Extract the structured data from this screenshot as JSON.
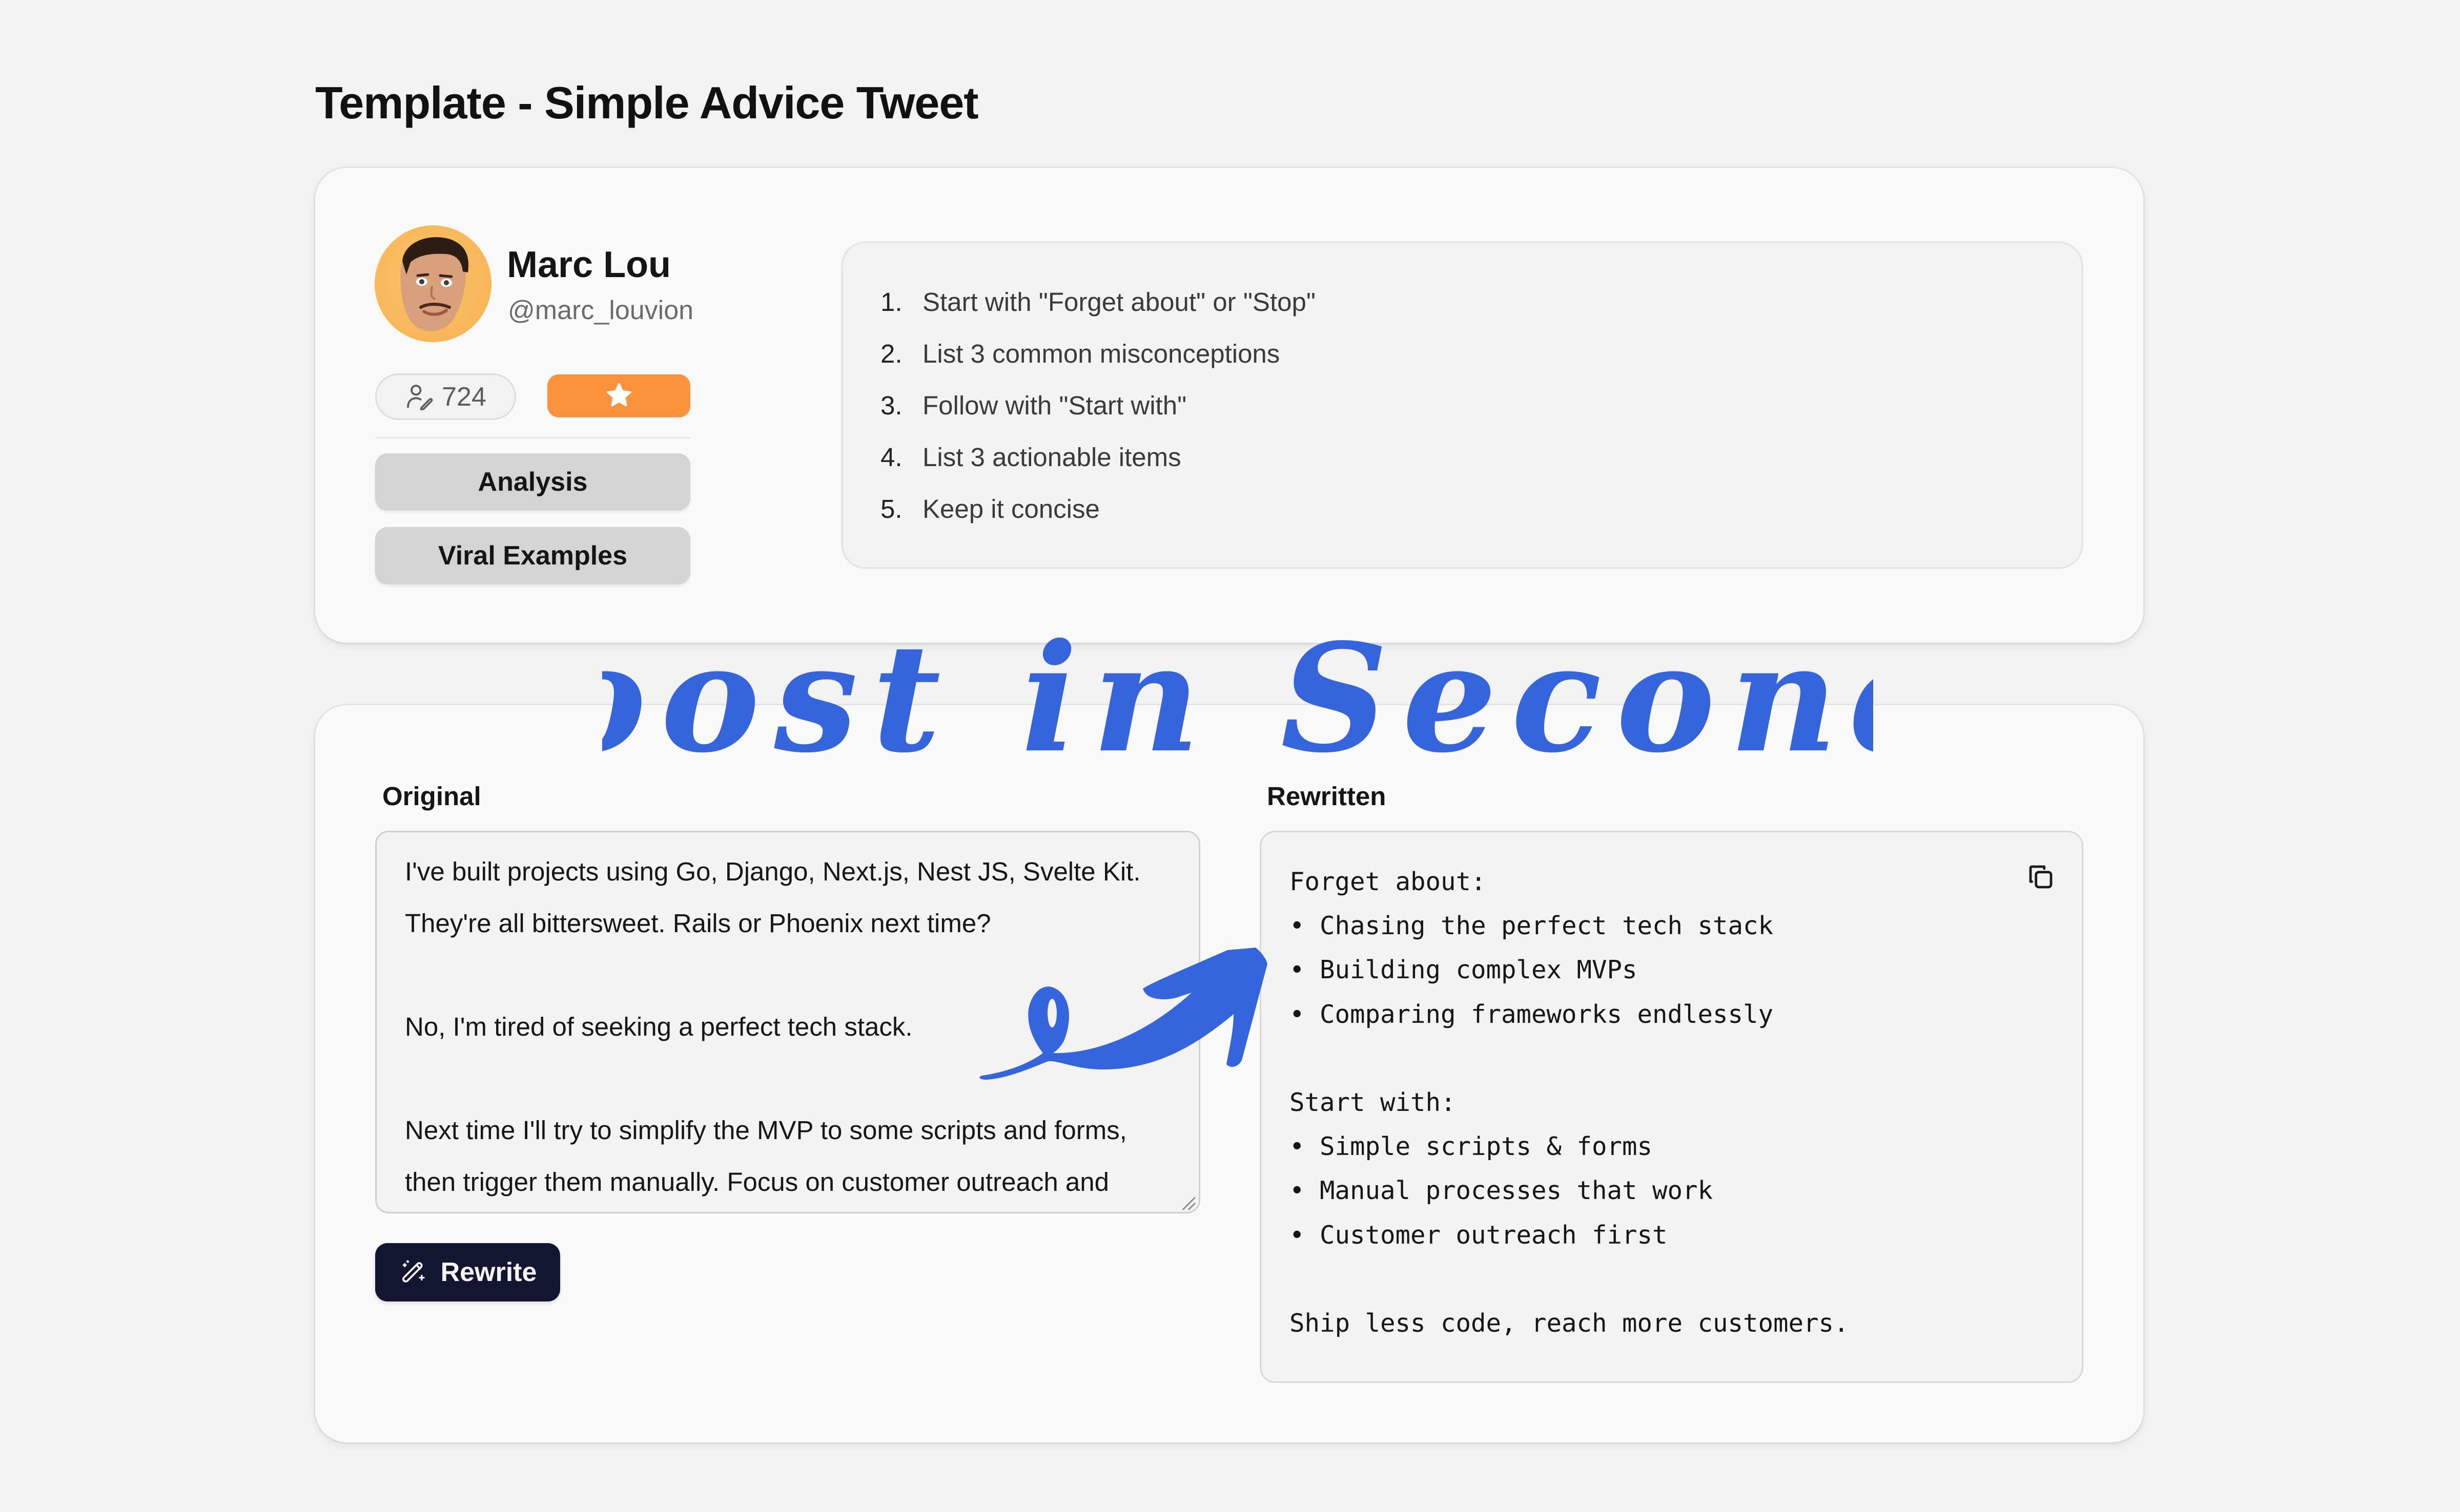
{
  "page": {
    "title": "Template - Simple Advice Tweet"
  },
  "profile": {
    "name": "Marc Lou",
    "handle": "@marc_louvion",
    "avatar_icon": "avatar-photo",
    "followers_icon": "user-pen-icon",
    "followers_count": "724",
    "favorite_icon": "star-icon",
    "favorite_color": "#fb923c",
    "buttons": [
      {
        "label": "Analysis"
      },
      {
        "label": "Viral Examples"
      }
    ]
  },
  "template_steps": [
    {
      "number": "1.",
      "text": "Start with \"Forget about\" or \"Stop\""
    },
    {
      "number": "2.",
      "text": "List 3 common misconceptions"
    },
    {
      "number": "3.",
      "text": "Follow with \"Start with\""
    },
    {
      "number": "4.",
      "text": "List 3 actionable items"
    },
    {
      "number": "5.",
      "text": "Keep it concise"
    }
  ],
  "original": {
    "label": "Original",
    "lines": [
      "I've built projects using Go, Django, Next.js, Nest JS, Svelte Kit.",
      "They're all bittersweet. Rails or Phoenix next time?",
      "",
      "No, I'm tired of seeking a perfect tech stack.",
      "",
      "Next time I'll try to simplify the MVP to some scripts and forms,",
      "then trigger them manually. Focus on customer outreach and"
    ]
  },
  "rewrite_button": {
    "label": "Rewrite",
    "icon": "magic-wand-icon",
    "color": "#121631"
  },
  "rewritten": {
    "label": "Rewritten",
    "copy_icon": "copy-icon",
    "lines": [
      "Forget about:",
      "• Chasing the perfect tech stack",
      "• Building complex MVPs",
      "• Comparing frameworks endlessly",
      "",
      "Start with:",
      "• Simple scripts & forms",
      "• Manual processes that work",
      "• Customer outreach first",
      "",
      "Ship less code, reach more customers."
    ]
  },
  "overlay": {
    "headline": "Boost in Seconds",
    "color": "#3665db",
    "arrow_icon": "curly-arrow-icon"
  }
}
